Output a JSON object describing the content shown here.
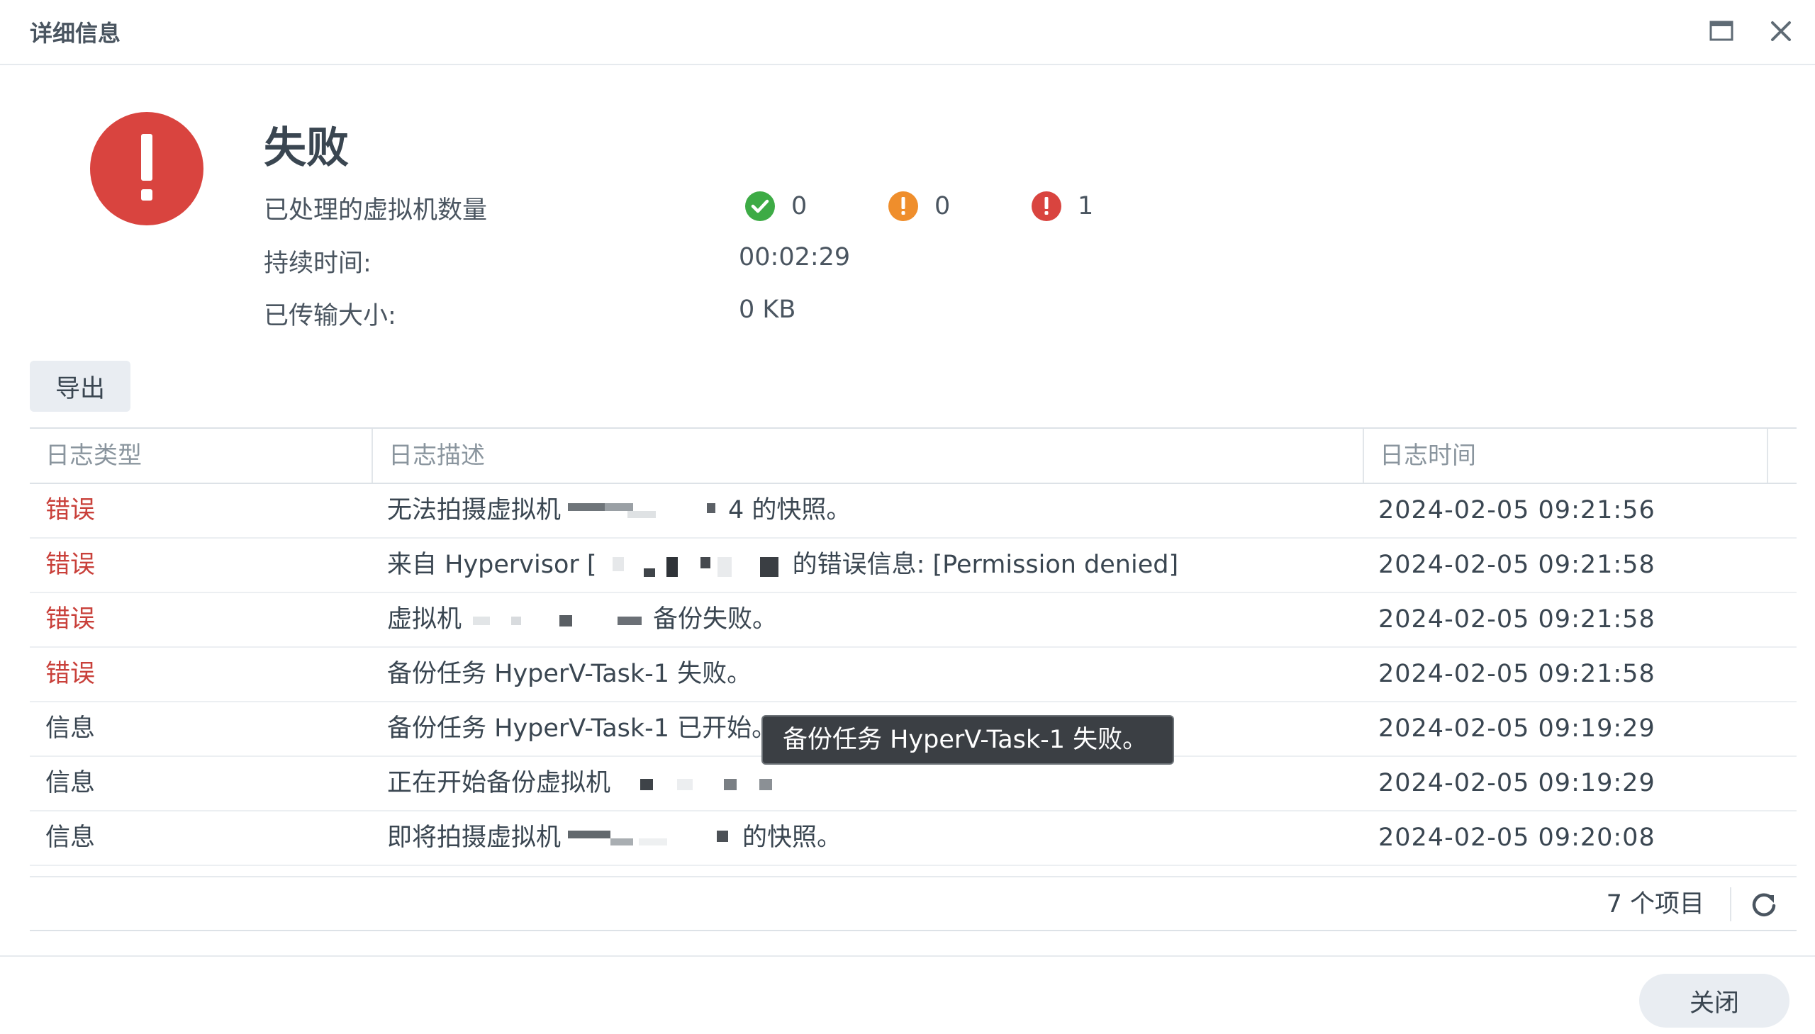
{
  "window": {
    "title": "详细信息"
  },
  "summary": {
    "status": "失败",
    "vm_count_label": "已处理的虚拟机数量",
    "success_count": "0",
    "warning_count": "0",
    "error_count": "1",
    "duration_label": "持续时间:",
    "duration_value": "00:02:29",
    "transfer_label": "已传输大小:",
    "transfer_value": "0 KB"
  },
  "toolbar": {
    "export_label": "导出"
  },
  "table": {
    "columns": [
      "日志类型",
      "日志描述",
      "日志时间"
    ],
    "rows": [
      {
        "type": "错误",
        "level": "error",
        "desc_before": "无法拍摄虚拟机",
        "desc_after": "4 的快照。",
        "time": "2024-02-05 09:21:56"
      },
      {
        "type": "错误",
        "level": "error",
        "desc_before": "来自 Hypervisor [",
        "desc_after": "的错误信息:  [Permission denied]",
        "time": "2024-02-05 09:21:58"
      },
      {
        "type": "错误",
        "level": "error",
        "desc_before": "虚拟机",
        "desc_after": "备份失败。",
        "time": "2024-02-05 09:21:58"
      },
      {
        "type": "错误",
        "level": "error",
        "desc_before": "备份任务 HyperV-Task-1 失败。",
        "desc_after": "",
        "time": "2024-02-05 09:21:58"
      },
      {
        "type": "信息",
        "level": "info",
        "desc_before": "备份任务 HyperV-Task-1 已开始。",
        "desc_after": "",
        "time": "2024-02-05 09:19:29"
      },
      {
        "type": "信息",
        "level": "info",
        "desc_before": "正在开始备份虚拟机",
        "desc_after": "",
        "time": "2024-02-05 09:19:29"
      },
      {
        "type": "信息",
        "level": "info",
        "desc_before": "即将拍摄虚拟机",
        "desc_after": "的快照。",
        "time": "2024-02-05 09:20:08"
      }
    ]
  },
  "tooltip": {
    "text": "备份任务 HyperV-Task-1 失败。"
  },
  "footer": {
    "item_count": "7 个项目"
  },
  "dialog": {
    "close_label": "关闭"
  },
  "icons": {
    "status": "error-circle-icon",
    "success": "check-circle-icon",
    "warning": "warning-circle-icon",
    "error": "error-circle-icon",
    "refresh": "refresh-icon",
    "maximize": "maximize-icon",
    "close": "close-icon"
  },
  "colors": {
    "error": "#d9443f",
    "success": "#3dab45",
    "warning": "#ef8e2c",
    "error_text": "#c9403a"
  }
}
